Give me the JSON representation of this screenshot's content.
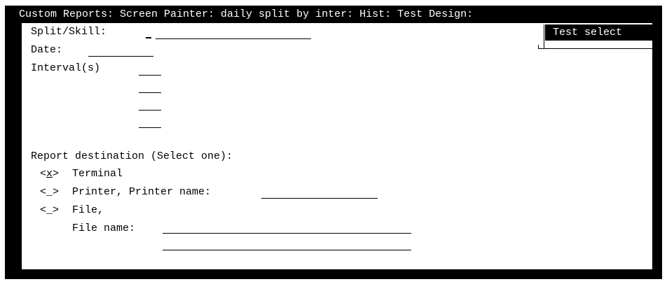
{
  "window": {
    "title": "Custom Reports: Screen Painter: daily split by inter: Hist: Test Design:"
  },
  "popup": {
    "label": "Test select"
  },
  "form": {
    "split_skill": {
      "label": "Split/Skill:",
      "value": ""
    },
    "date": {
      "label": "Date:",
      "value": ""
    },
    "intervals": {
      "label": "Interval(s)",
      "values": [
        "",
        "",
        "",
        ""
      ]
    },
    "destination": {
      "heading": "Report destination (Select one):",
      "options": [
        {
          "open": "<",
          "mark": "x",
          "close": ">",
          "label": "Terminal",
          "selected": true
        },
        {
          "open": "<",
          "mark": "_",
          "close": ">",
          "label": "Printer, Printer name:",
          "selected": false
        },
        {
          "open": "<",
          "mark": "_",
          "close": ">",
          "label": "File,",
          "selected": false
        }
      ],
      "file_name_label": "File name:",
      "printer_name_value": "",
      "file_name_value": ""
    }
  },
  "colors": {
    "frame": "#000000",
    "panel": "#ffffff",
    "title_text": "#ffffff"
  }
}
